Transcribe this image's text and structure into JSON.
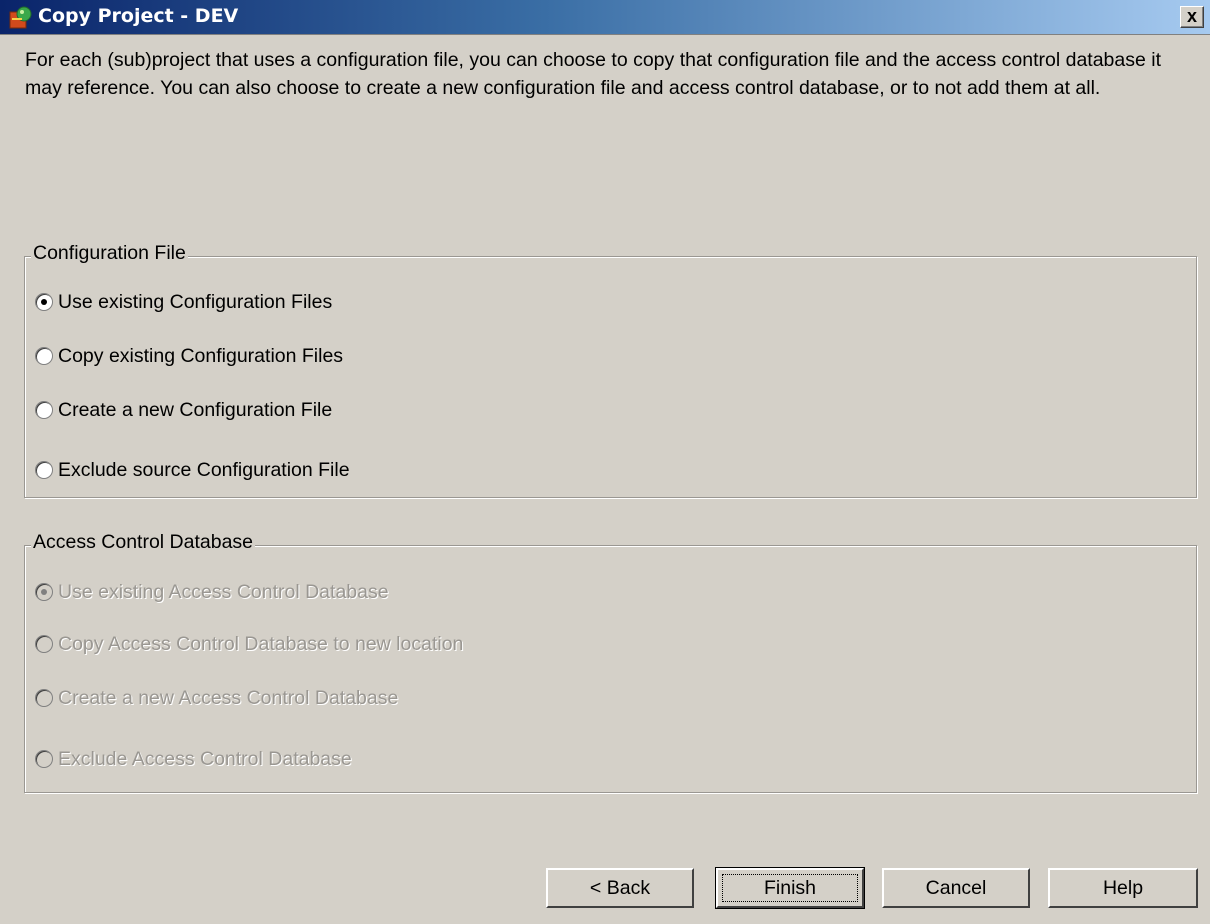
{
  "window": {
    "title": "Copy Project - DEV",
    "close_label": "x"
  },
  "intro": "For each (sub)project that uses a configuration file, you can choose to copy that configuration file and the access control database it may reference. You can also choose to create a new configuration file and access control database, or to not add them at all.",
  "config_group": {
    "legend": "Configuration File",
    "options": [
      {
        "label": "Use existing Configuration Files",
        "checked": true
      },
      {
        "label": "Copy existing Configuration Files",
        "checked": false
      },
      {
        "label": "Create a new Configuration File",
        "checked": false
      },
      {
        "label": "Exclude source Configuration File",
        "checked": false
      }
    ]
  },
  "acl_group": {
    "legend": "Access Control Database",
    "disabled": true,
    "options": [
      {
        "label": "Use existing Access Control Database",
        "checked": true
      },
      {
        "label": "Copy Access Control Database to new location",
        "checked": false
      },
      {
        "label": "Create a new Access Control Database",
        "checked": false
      },
      {
        "label": "Exclude Access Control Database",
        "checked": false
      }
    ]
  },
  "buttons": {
    "back": "< Back",
    "finish": "Finish",
    "cancel": "Cancel",
    "help": "Help"
  }
}
